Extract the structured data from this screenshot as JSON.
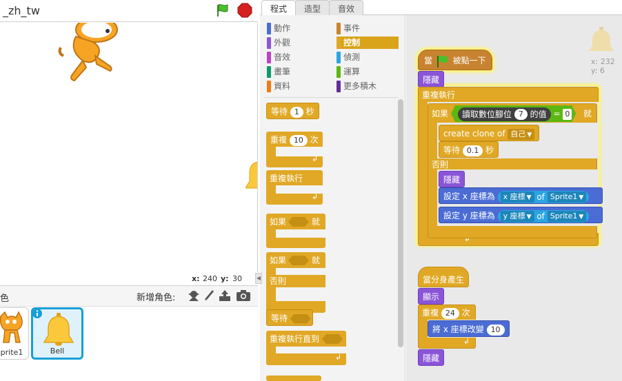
{
  "project": {
    "title": "_zh_tw"
  },
  "stage": {
    "coords": {
      "x_label": "x:",
      "x_value": "240",
      "y_label": "y:",
      "y_value": "30"
    }
  },
  "sprites": {
    "section_label": "色",
    "new_sprite_label": "新增角色:",
    "items": [
      {
        "name": "prite1"
      },
      {
        "name": "Bell"
      }
    ]
  },
  "tabs": [
    {
      "label": "程式"
    },
    {
      "label": "造型"
    },
    {
      "label": "音效"
    }
  ],
  "categories": [
    {
      "label": "動作",
      "color": "#4a6cd4"
    },
    {
      "label": "事件",
      "color": "#c88330"
    },
    {
      "label": "外觀",
      "color": "#8a55d7"
    },
    {
      "label": "控制",
      "color": "#e0a825"
    },
    {
      "label": "音效",
      "color": "#bb42c3"
    },
    {
      "label": "偵測",
      "color": "#2ca5e2"
    },
    {
      "label": "畫筆",
      "color": "#0e9a6c"
    },
    {
      "label": "運算",
      "color": "#5cb712"
    },
    {
      "label": "資料",
      "color": "#ee7d16"
    },
    {
      "label": "更多積木",
      "color": "#632d99"
    }
  ],
  "palette_blocks": {
    "wait": {
      "pre": "等待",
      "value": "1",
      "post": "秒"
    },
    "repeat": {
      "pre": "重複",
      "value": "10",
      "post": "次"
    },
    "forever": {
      "label": "重複執行"
    },
    "if_then": {
      "pre": "如果",
      "post": "就"
    },
    "if_else": {
      "pre": "如果",
      "post": "就",
      "else_label": "否則"
    },
    "wait_until": {
      "label": "等待"
    },
    "repeat_until": {
      "label": "重複執行直到"
    }
  },
  "script1": {
    "hat": {
      "pre": "當",
      "post": "被點一下"
    },
    "hide1": "隱藏",
    "forever": "重複執行",
    "if_label": "如果",
    "sensor_text": "讀取數位腳位",
    "pin_value": "7",
    "sensor_post": "的值",
    "equals": "=",
    "compare_value": "0",
    "then_label": "就",
    "create_clone_pre": "create clone of",
    "create_clone_target": "自己",
    "wait_pre": "等待",
    "wait_value": "0.1",
    "wait_post": "秒",
    "else_label": "否則",
    "hide2": "隱藏",
    "set_x_pre": "設定 x 座標為",
    "x_attr": "x 座標",
    "of_label": "of",
    "sprite_x": "Sprite1",
    "set_y_pre": "設定 y 座標為",
    "y_attr": "y 座標",
    "sprite_y": "Sprite1"
  },
  "script2": {
    "hat": "當分身產生",
    "show": "顯示",
    "repeat_pre": "重複",
    "repeat_value": "24",
    "repeat_post": "次",
    "change_pre": "將 x 座標改變",
    "change_value": "10",
    "hide": "隱藏"
  },
  "sprite_info": {
    "x_label": "x:",
    "x_value": "232",
    "y_label": "y:",
    "y_value": "6"
  }
}
